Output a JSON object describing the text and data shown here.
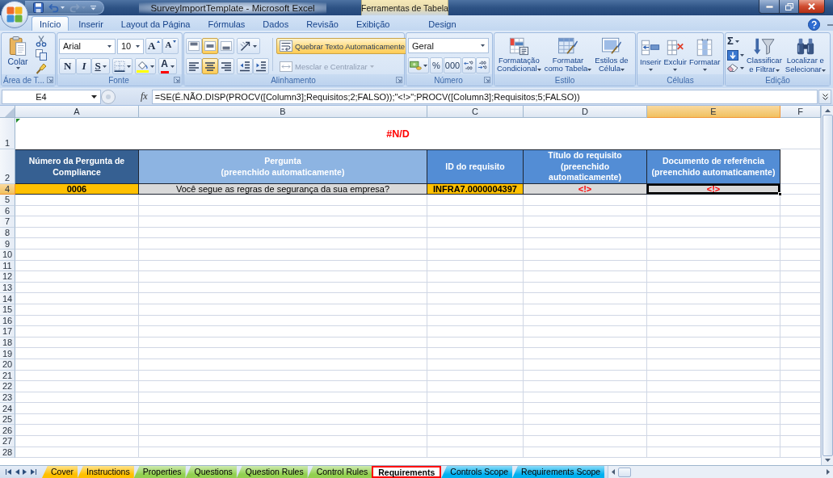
{
  "window": {
    "title": "SurveyImportTemplate - Microsoft Excel"
  },
  "quick_access": [
    {
      "kind": "save",
      "disabled": false
    },
    {
      "kind": "undo",
      "disabled": false
    },
    {
      "kind": "redo",
      "disabled": true
    },
    {
      "kind": "customize",
      "disabled": false
    }
  ],
  "ribbon_tabs": [
    {
      "label": "Início",
      "selected": true
    },
    {
      "label": "Inserir",
      "selected": false
    },
    {
      "label": "Layout da Página",
      "selected": false
    },
    {
      "label": "Fórmulas",
      "selected": false
    },
    {
      "label": "Dados",
      "selected": false
    },
    {
      "label": "Revisão",
      "selected": false
    },
    {
      "label": "Exibição",
      "selected": false
    }
  ],
  "context_tabs": {
    "label": "Ferramentas de Tabela",
    "tabs": [
      {
        "label": "Design",
        "selected": false
      }
    ]
  },
  "ribbon": {
    "clipboard": {
      "label": "Área de T...",
      "paste": "Colar"
    },
    "font": {
      "label": "Fonte",
      "font_name": "Arial",
      "font_size": "10",
      "grow": "A",
      "shrink": "A",
      "bold": "N",
      "italic": "I",
      "underline": "S",
      "font_color": "A"
    },
    "alignment": {
      "label": "Alinhamento",
      "vertical": [
        {
          "kind": "top",
          "selected": false
        },
        {
          "kind": "middle",
          "selected": true
        },
        {
          "kind": "bottom",
          "selected": false
        }
      ],
      "horizontal": [
        {
          "kind": "left",
          "selected": false
        },
        {
          "kind": "center",
          "selected": true
        },
        {
          "kind": "right",
          "selected": false
        }
      ],
      "wrap_text": {
        "label": "Quebrar Texto Automaticamente",
        "on": true
      },
      "merge": {
        "label": "Mesclar e Centralizar",
        "disabled": true
      }
    },
    "number": {
      "label": "Número",
      "format": "Geral",
      "percent": "%",
      "thousands": "000"
    },
    "styles": {
      "label": "Estilo",
      "buttons": [
        {
          "kind": "conditional",
          "lines": [
            "Formatação",
            "Condicional"
          ]
        },
        {
          "kind": "table",
          "lines": [
            "Formatar",
            "como Tabela"
          ]
        },
        {
          "kind": "cell_styles",
          "lines": [
            "Estilos de",
            "Célula"
          ]
        }
      ]
    },
    "cells": {
      "label": "Células",
      "buttons": [
        {
          "kind": "insert",
          "label": "Inserir"
        },
        {
          "kind": "delete",
          "label": "Excluir"
        },
        {
          "kind": "format",
          "label": "Formatar"
        }
      ]
    },
    "editing": {
      "label": "Edição",
      "sum": "Σ",
      "buttons": [
        {
          "kind": "sort",
          "lines": [
            "Classificar",
            "e Filtrar"
          ]
        },
        {
          "kind": "find",
          "lines": [
            "Localizar e",
            "Selecionar"
          ]
        }
      ]
    }
  },
  "formula_bar": {
    "name_box": "E4",
    "function_button": "fx",
    "formula": "=SE(É.NÃO.DISP(PROCV([Column3];Requisitos;2;FALSO));\"<!>\";PROCV([Column3];Requisitos;5;FALSO))"
  },
  "sheet": {
    "columns": [
      {
        "label": "A",
        "selected": false
      },
      {
        "label": "B",
        "selected": false
      },
      {
        "label": "C",
        "selected": false
      },
      {
        "label": "D",
        "selected": false
      },
      {
        "label": "E",
        "selected": true
      },
      {
        "label": "F",
        "selected": false
      }
    ],
    "rows": [
      {
        "label": "1",
        "kind": "title",
        "selected": false,
        "text": "#N/D"
      },
      {
        "label": "2",
        "kind": "header",
        "selected": false,
        "cells": [
          {
            "text": "Número da Pergunta de Compliance",
            "color": "#366092"
          },
          {
            "text": "Pergunta\n(preenchido automaticamente)",
            "color": "#8db4e2"
          },
          {
            "text": "ID do requisito",
            "color": "#538dd5"
          },
          {
            "text": "Título do requisito (preenchido automaticamente)",
            "color": "#538dd5"
          },
          {
            "text": "Documento de referência (preenchido automaticamente)",
            "color": "#538dd5"
          }
        ]
      },
      {
        "label": "4",
        "kind": "data",
        "selected": true,
        "cells": [
          {
            "kind": "key",
            "text": "0006",
            "color": "#ffc000",
            "selected": false
          },
          {
            "kind": "text",
            "text": "Você segue as regras de segurança da sua empresa?",
            "color": "#d9d9d9",
            "selected": false
          },
          {
            "kind": "key",
            "text": "INFRA7.0000004397",
            "color": "#ffc000",
            "selected": false
          },
          {
            "kind": "flag",
            "text": "<!>",
            "color": "#d9d9d9",
            "selected": false
          },
          {
            "kind": "flag",
            "text": "<!>",
            "color": "#d9d9d9",
            "selected": true
          }
        ]
      },
      {
        "label": "5",
        "kind": "empty",
        "selected": false
      },
      {
        "label": "6",
        "kind": "empty",
        "selected": false
      },
      {
        "label": "7",
        "kind": "empty",
        "selected": false
      },
      {
        "label": "8",
        "kind": "empty",
        "selected": false
      },
      {
        "label": "9",
        "kind": "empty",
        "selected": false
      },
      {
        "label": "10",
        "kind": "empty",
        "selected": false
      },
      {
        "label": "11",
        "kind": "empty",
        "selected": false
      },
      {
        "label": "12",
        "kind": "empty",
        "selected": false
      },
      {
        "label": "13",
        "kind": "empty",
        "selected": false
      },
      {
        "label": "14",
        "kind": "empty",
        "selected": false
      },
      {
        "label": "15",
        "kind": "empty",
        "selected": false
      },
      {
        "label": "16",
        "kind": "empty",
        "selected": false
      },
      {
        "label": "17",
        "kind": "empty",
        "selected": false
      },
      {
        "label": "18",
        "kind": "empty",
        "selected": false
      },
      {
        "label": "19",
        "kind": "empty",
        "selected": false
      },
      {
        "label": "20",
        "kind": "empty",
        "selected": false
      },
      {
        "label": "21",
        "kind": "empty",
        "selected": false
      },
      {
        "label": "22",
        "kind": "empty",
        "selected": false
      },
      {
        "label": "23",
        "kind": "empty",
        "selected": false
      },
      {
        "label": "24",
        "kind": "empty",
        "selected": false
      },
      {
        "label": "25",
        "kind": "empty",
        "selected": false
      },
      {
        "label": "26",
        "kind": "empty",
        "selected": false
      },
      {
        "label": "27",
        "kind": "empty",
        "selected": false
      },
      {
        "label": "28",
        "kind": "empty",
        "selected": false
      }
    ]
  },
  "sheet_tabs": [
    {
      "label": "Cover",
      "color": "#ffc000",
      "selected": false
    },
    {
      "label": "Instructions",
      "color": "#ffc000",
      "selected": false
    },
    {
      "label": "Properties",
      "color": "#92d050",
      "selected": false
    },
    {
      "label": "Questions",
      "color": "#92d050",
      "selected": false
    },
    {
      "label": "Question Rules",
      "color": "#92d050",
      "selected": false
    },
    {
      "label": "Control Rules",
      "color": "#92d050",
      "selected": false
    },
    {
      "label": "Requirements",
      "color": "#ff0000",
      "selected": true
    },
    {
      "label": "Controls Scope",
      "color": "#00b0f0",
      "selected": false
    },
    {
      "label": "Requirements Scope",
      "color": "#00b0f0",
      "selected": false
    }
  ]
}
